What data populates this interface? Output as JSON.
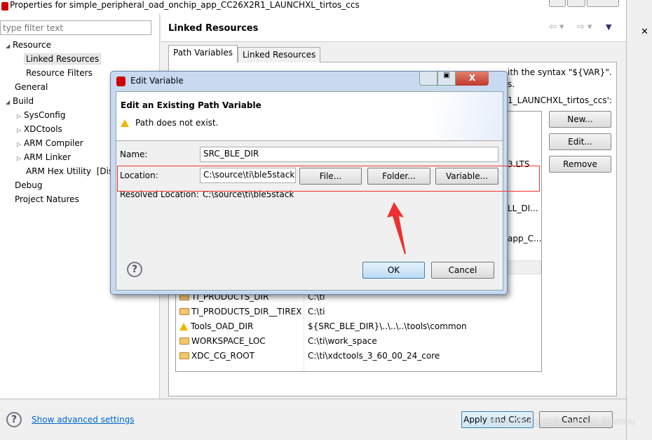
{
  "window": {
    "title": "Properties for simple_peripheral_oad_onchip_app_CC26X2R1_LAUNCHXL_tirtos_ccs"
  },
  "sidebar": {
    "filter_placeholder": "type filter text",
    "items": [
      {
        "label": "Resource",
        "expanded": true
      },
      {
        "label": "Linked Resources",
        "selected": true
      },
      {
        "label": "Resource Filters"
      },
      {
        "label": "General"
      },
      {
        "label": "Build",
        "expanded": true
      },
      {
        "label": "SysConfig"
      },
      {
        "label": "XDCtools"
      },
      {
        "label": "ARM Compiler"
      },
      {
        "label": "ARM Linker"
      },
      {
        "label": "ARM Hex Utility  [Dis"
      },
      {
        "label": "Debug"
      },
      {
        "label": "Project Natures"
      }
    ]
  },
  "page": {
    "title": "Linked Resources",
    "tabs": [
      {
        "label": "Path Variables",
        "active": true
      },
      {
        "label": "Linked Resources"
      }
    ],
    "desc_fragments": [
      "ith the syntax \"${VAR}\".",
      "s.",
      "1_LAUNCHXL_tirtos_ccs':"
    ],
    "buttons": {
      "new": "New...",
      "edit": "Edit...",
      "remove": "Remove"
    },
    "partial_values": [
      "3.LTS",
      "LL_DI...",
      "app_C..."
    ],
    "rows": [
      {
        "name": "TI_PRODUCTS_DIR",
        "value": "C:\\ti",
        "icon": "folder"
      },
      {
        "name": "TI_PRODUCTS_DIR__TIREX",
        "value": "C:\\ti",
        "icon": "folder"
      },
      {
        "name": "Tools_OAD_DIR",
        "value": "${SRC_BLE_DIR}\\..\\..\\..\\tools\\common",
        "icon": "warning"
      },
      {
        "name": "WORKSPACE_LOC",
        "value": "C:\\ti\\work_space",
        "icon": "folder"
      },
      {
        "name": "XDC_CG_ROOT",
        "value": "C:\\ti\\xdctools_3_60_00_24_core",
        "icon": "folder"
      }
    ]
  },
  "dialog": {
    "title": "Edit Variable",
    "heading": "Edit an Existing Path Variable",
    "message": "Path does not exist.",
    "name_label": "Name:",
    "name_value": "SRC_BLE_DIR",
    "location_label": "Location:",
    "location_value": "C:\\source\\ti\\ble5stack",
    "file_btn": "File...",
    "folder_btn": "Folder...",
    "variable_btn": "Variable...",
    "resolved_label": "Resolved Location:",
    "resolved_value": "C:\\source\\ti\\ble5stack",
    "ok": "OK",
    "cancel": "Cancel"
  },
  "footer": {
    "advanced_link": "Show advanced settings",
    "apply_close": "Apply and Close",
    "cancel": "Cancel"
  },
  "watermark": "https://blog.csdn.net/zhi_Alanwu",
  "colors": {
    "annotation": "#f03030",
    "link": "#0066cc",
    "ok_button": "#cfe6fa"
  }
}
